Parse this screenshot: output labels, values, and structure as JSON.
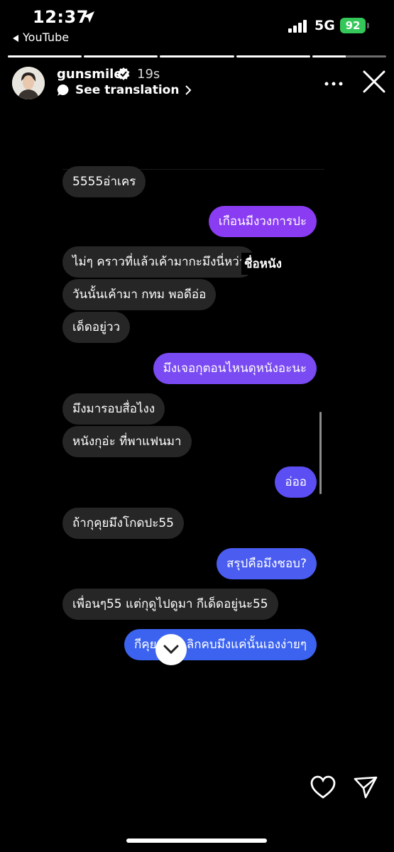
{
  "status_bar": {
    "time": "12:37",
    "back_app": "YouTube",
    "network": "5G",
    "battery": "92"
  },
  "story": {
    "segments": [
      1,
      1,
      1,
      1,
      0.45
    ],
    "username": "gunsmile",
    "age": "19s",
    "translation_label": "See translation"
  },
  "messages": [
    {
      "side": "in",
      "text": "5555อ่าเคร"
    },
    {
      "side": "out",
      "text": "เกือนมีงวงการปะ",
      "color": "#8a3cf3"
    },
    {
      "side": "in",
      "text": "ไม่ๆ คราวที่แล้วเค้ามากะมึงนี่หว่า"
    },
    {
      "side": "in",
      "text": "วันนั้นเค้ามา กทม พอดีอ่อ"
    },
    {
      "side": "in",
      "text": "เด็ดอยู่วว"
    },
    {
      "side": "out",
      "text": "มึงเจอกุตอนไหนดุหนังอะนะ",
      "color": "#7a4af3"
    },
    {
      "side": "in",
      "text": "มึงมารอบสื่อไงง"
    },
    {
      "side": "in",
      "text": "หนังกุอ่ะ ที่พาแฟนมา"
    },
    {
      "side": "out",
      "text": "อ่ออ",
      "color": "#5b4ef2"
    },
    {
      "side": "in",
      "text": "ถ้ากุคุยมึงโกดปะ55"
    },
    {
      "side": "out",
      "text": "สรุปคือมึงชอบ?",
      "color": "#4a5df0"
    },
    {
      "side": "in",
      "text": "เพื่อนๆ55 แต่กุดูไปดูมา กีเด็ดอยู่นะ55"
    },
    {
      "side": "out",
      "text": "กีคุย แล้วเลิกคบมึงแค่นั้นเองง่ายๆ",
      "color": "#3b63ef"
    }
  ],
  "sticker_text": "ชื่อหนัง"
}
